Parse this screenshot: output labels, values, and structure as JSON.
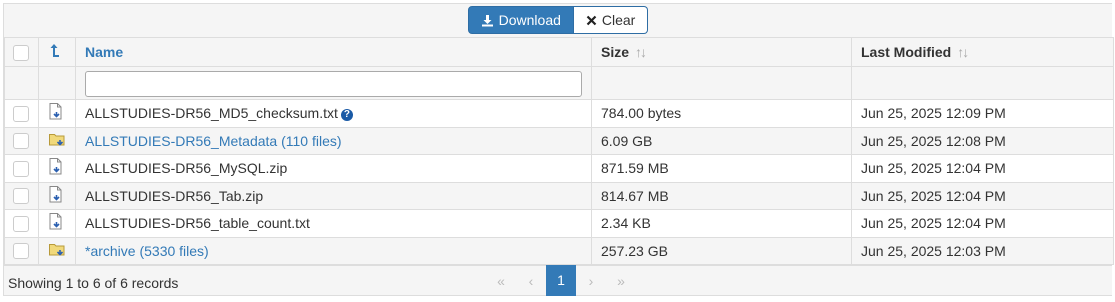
{
  "toolbar": {
    "download_label": "Download",
    "clear_label": "Clear"
  },
  "table": {
    "headers": {
      "name": "Name",
      "size": "Size",
      "modified": "Last Modified"
    },
    "sort_indicator": "↑↓",
    "rows": [
      {
        "name": "ALLSTUDIES-DR56_MD5_checksum.txt",
        "size": "784.00 bytes",
        "modified": "Jun 25, 2025 12:09 PM",
        "type": "file",
        "help": "?"
      },
      {
        "name": "ALLSTUDIES-DR56_Metadata (110 files)",
        "size": "6.09 GB",
        "modified": "Jun 25, 2025 12:08 PM",
        "type": "folder"
      },
      {
        "name": "ALLSTUDIES-DR56_MySQL.zip",
        "size": "871.59 MB",
        "modified": "Jun 25, 2025 12:04 PM",
        "type": "file"
      },
      {
        "name": "ALLSTUDIES-DR56_Tab.zip",
        "size": "814.67 MB",
        "modified": "Jun 25, 2025 12:04 PM",
        "type": "file"
      },
      {
        "name": "ALLSTUDIES-DR56_table_count.txt",
        "size": "2.34 KB",
        "modified": "Jun 25, 2025 12:04 PM",
        "type": "file"
      },
      {
        "name": "*archive (5330 files)",
        "size": "257.23 GB",
        "modified": "Jun 25, 2025 12:03 PM",
        "type": "folder"
      }
    ]
  },
  "footer": {
    "info": "Showing 1 to 6 of 6 records",
    "pager": {
      "first": "«",
      "prev": "‹",
      "current": "1",
      "next": "›",
      "last": "»"
    }
  },
  "colors": {
    "accent": "#337ab7",
    "folder": "#f1d97a"
  }
}
